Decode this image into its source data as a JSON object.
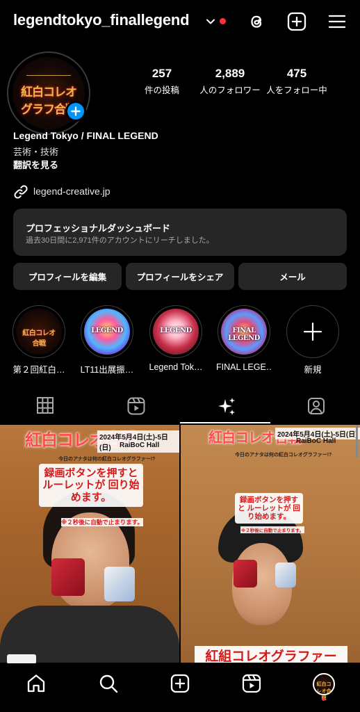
{
  "profile": {
    "username": "legendtokyo_finallegend",
    "display_name": "Legend Tokyo / FINAL LEGEND",
    "category": "芸術・技術",
    "translate_label": "翻訳を見る",
    "website": "legend-creative.jp",
    "avatar_text": "紅白コレオグラフ合戦"
  },
  "stats": [
    {
      "value": "257",
      "label": "件の投稿"
    },
    {
      "value": "2,889",
      "label": "人のフォロワー"
    },
    {
      "value": "475",
      "label": "人をフォロー中"
    }
  ],
  "dashboard": {
    "title": "プロフェッショナルダッシュボード",
    "subtitle": "過去30日間に2,971件のアカウントにリーチしました。"
  },
  "buttons": {
    "edit_profile": "プロフィールを編集",
    "share_profile": "プロフィールをシェア",
    "email": "メール"
  },
  "highlights": [
    {
      "label": "第２回紅白…",
      "thumb_text": "紅白コレオ合戦"
    },
    {
      "label": "LT11出展振…",
      "thumb_text": "LEGEND"
    },
    {
      "label": "Legend Tok…",
      "thumb_text": "LEGEND"
    },
    {
      "label": "FINAL LEGE…",
      "thumb_text": "FINAL LEGEND"
    },
    {
      "label": "新規"
    }
  ],
  "tabs": [
    "grid-icon",
    "reels-icon",
    "sparkles-icon",
    "tagged-icon"
  ],
  "posts": [
    {
      "title": "紅白コレオ合戦",
      "date": "2024年5月4日(土)-5日(日)",
      "hall": "RaiBoC Hall",
      "caption_line": "今日のアナタは何の紅白コレオグラファー!?",
      "banner": "録画ボタンを押すと ルーレットが 回り始めます。",
      "note": "※２秒後に自動で止まります。"
    },
    {
      "title": "紅白コレオ合戦",
      "date": "2024年5月4日(土)-5日(日)",
      "hall": "RaiBoC Hall",
      "caption_line": "今日のアナタは何の紅白コレオグラファー!?",
      "banner": "録画ボタンを押すと ルーレットが 回り始めます。",
      "note": "※２秒後に自動で止まります。",
      "bottom_text": "紅組コレオグラファー"
    }
  ],
  "nav": [
    "home-icon",
    "search-icon",
    "create-icon",
    "reels-icon",
    "profile-avatar"
  ],
  "colors": {
    "accent_blue": "#0095f6",
    "notification_red": "#ff3040",
    "button_bg": "#262626"
  }
}
